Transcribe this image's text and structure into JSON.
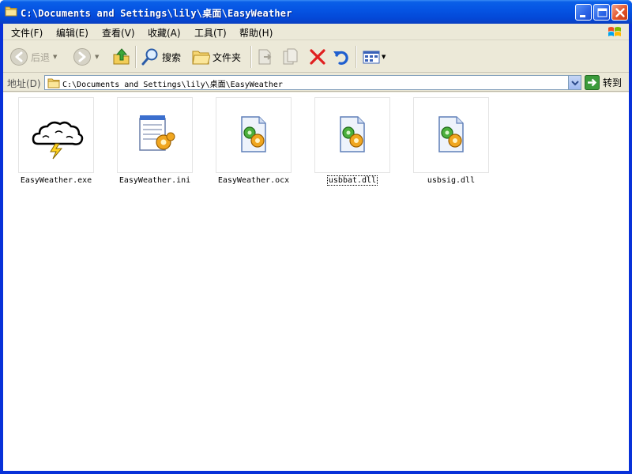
{
  "window": {
    "title": "C:\\Documents and Settings\\lily\\桌面\\EasyWeather",
    "controls": [
      "minimize",
      "maximize",
      "close"
    ]
  },
  "menu": {
    "file": "文件(F)",
    "edit": "编辑(E)",
    "view": "查看(V)",
    "favorites": "收藏(A)",
    "tools": "工具(T)",
    "help": "帮助(H)"
  },
  "toolbar": {
    "back": "后退",
    "search": "搜索",
    "folders": "文件夹",
    "icons": {
      "back": "back-arrow-icon",
      "forward": "forward-arrow-icon",
      "up": "up-folder-icon",
      "search": "magnifier-icon",
      "folders": "folder-icon",
      "move_to": "move-to-icon",
      "copy_to": "copy-to-icon",
      "delete": "delete-x-icon",
      "undo": "undo-icon",
      "views": "views-icon"
    }
  },
  "address": {
    "label": "地址(D)",
    "value": "C:\\Documents and Settings\\lily\\桌面\\EasyWeather",
    "go": "转到"
  },
  "files": [
    {
      "name": "EasyWeather.exe",
      "icon": "weather-cloud-icon"
    },
    {
      "name": "EasyWeather.ini",
      "icon": "config-notepad-icon"
    },
    {
      "name": "EasyWeather.ocx",
      "icon": "activex-gear-icon"
    },
    {
      "name": "usbbat.dll",
      "icon": "dll-gear-icon",
      "focused": true
    },
    {
      "name": "usbsig.dll",
      "icon": "dll-gear-icon"
    }
  ],
  "colors": {
    "titlebar": "#0553e2",
    "chrome": "#ece9d8",
    "delete_red": "#e02020",
    "close_button": "#e2552a"
  }
}
